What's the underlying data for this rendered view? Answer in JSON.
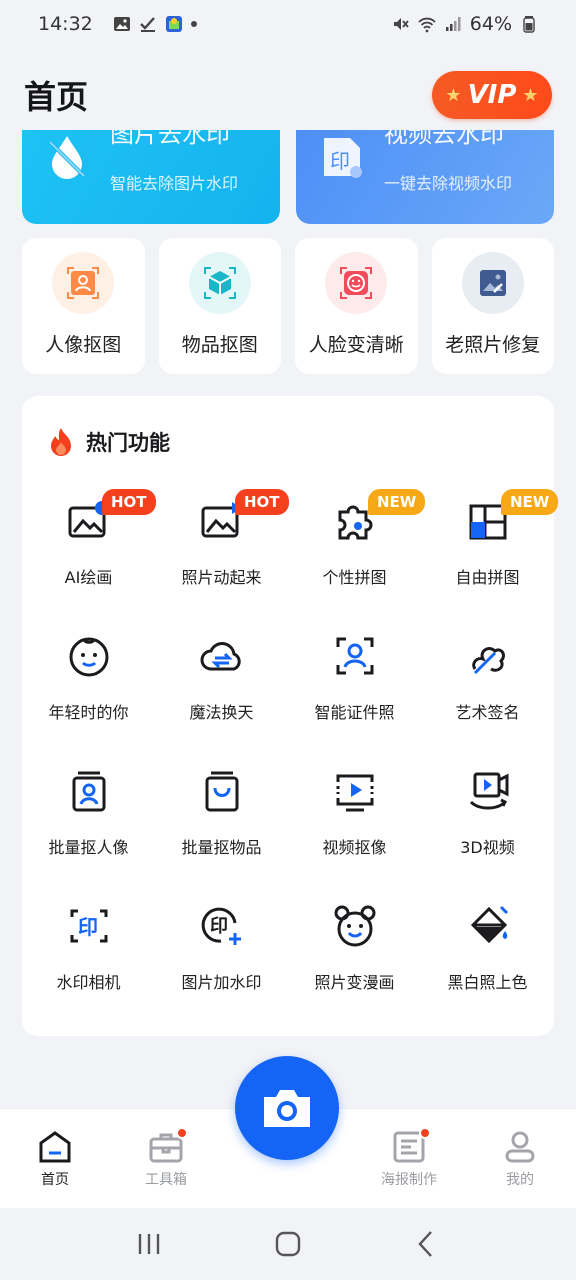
{
  "status_bar": {
    "time": "14:32",
    "battery": "64%",
    "icons_left": [
      "gallery-icon",
      "check-icon",
      "app-icon"
    ],
    "icons_right": [
      "mute-icon",
      "wifi-icon",
      "signal-icon",
      "battery-icon"
    ]
  },
  "header": {
    "title": "首页",
    "vip_label": "VIP"
  },
  "banners": [
    {
      "title": "图片去水印",
      "subtitle": "智能去除图片水印",
      "icon": "drop-icon"
    },
    {
      "title": "视频去水印",
      "subtitle": "一键去除视频水印",
      "icon": "video-watermark-icon"
    }
  ],
  "quick_tools": [
    {
      "label": "人像抠图",
      "icon": "portrait-cutout-icon",
      "color": "#ff7a2e"
    },
    {
      "label": "物品抠图",
      "icon": "object-cutout-icon",
      "color": "#18b6c8"
    },
    {
      "label": "人脸变清晰",
      "icon": "face-enhance-icon",
      "color": "#f24c5a"
    },
    {
      "label": "老照片修复",
      "icon": "photo-repair-icon",
      "color": "#3f5b8f"
    }
  ],
  "hot_section": {
    "title": "热门功能",
    "items": [
      {
        "label": "AI绘画",
        "icon": "ai-paint-icon",
        "badge": "HOT"
      },
      {
        "label": "照片动起来",
        "icon": "photo-animate-icon",
        "badge": "HOT"
      },
      {
        "label": "个性拼图",
        "icon": "puzzle-icon",
        "badge": "NEW"
      },
      {
        "label": "自由拼图",
        "icon": "collage-icon",
        "badge": "NEW"
      },
      {
        "label": "年轻时的你",
        "icon": "baby-face-icon",
        "badge": ""
      },
      {
        "label": "魔法换天",
        "icon": "cloud-swap-icon",
        "badge": ""
      },
      {
        "label": "智能证件照",
        "icon": "id-photo-icon",
        "badge": ""
      },
      {
        "label": "艺术签名",
        "icon": "signature-icon",
        "badge": ""
      },
      {
        "label": "批量抠人像",
        "icon": "batch-portrait-icon",
        "badge": ""
      },
      {
        "label": "批量抠物品",
        "icon": "batch-object-icon",
        "badge": ""
      },
      {
        "label": "视频抠像",
        "icon": "video-cutout-icon",
        "badge": ""
      },
      {
        "label": "3D视频",
        "icon": "3d-video-icon",
        "badge": ""
      },
      {
        "label": "水印相机",
        "icon": "watermark-camera-icon",
        "badge": ""
      },
      {
        "label": "图片加水印",
        "icon": "add-watermark-icon",
        "badge": ""
      },
      {
        "label": "照片变漫画",
        "icon": "cartoon-icon",
        "badge": ""
      },
      {
        "label": "黑白照上色",
        "icon": "colorize-icon",
        "badge": ""
      }
    ]
  },
  "bottom_nav": [
    {
      "label": "首页",
      "icon": "home-icon",
      "active": true,
      "dot": false
    },
    {
      "label": "工具箱",
      "icon": "toolbox-icon",
      "active": false,
      "dot": true
    },
    {
      "label": "海报制作",
      "icon": "poster-icon",
      "active": false,
      "dot": true
    },
    {
      "label": "我的",
      "icon": "profile-icon",
      "active": false,
      "dot": false
    }
  ],
  "colors": {
    "primary": "#1464f5",
    "hot_badge": "#f5401d",
    "new_badge": "#f7a816",
    "vip": "#f55a25"
  }
}
